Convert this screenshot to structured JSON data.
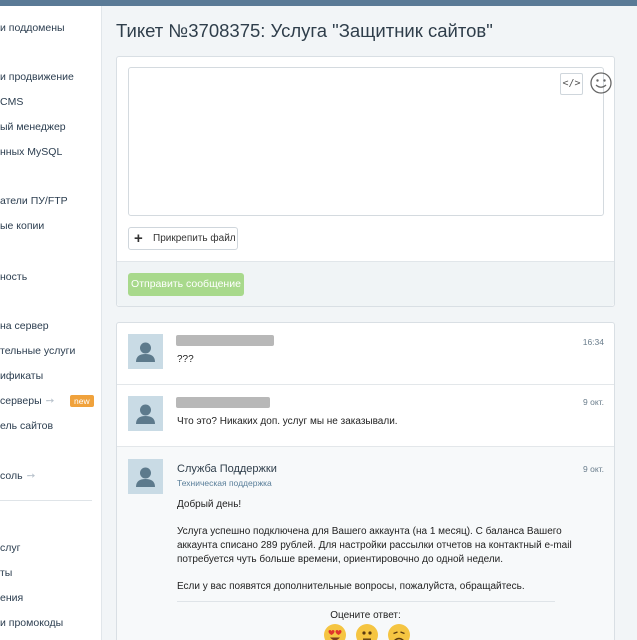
{
  "sidebar": {
    "items": [
      {
        "label": "и поддомены"
      },
      {
        "label": "и продвижение"
      },
      {
        "label": "CMS"
      },
      {
        "label": "ый менеджер"
      },
      {
        "label": "нных MySQL"
      },
      {
        "label": "атели ПУ/FTP"
      },
      {
        "label": "ые копии"
      },
      {
        "label": "ность"
      },
      {
        "label": "на сервер"
      },
      {
        "label": "тельные услуги"
      },
      {
        "label": "ификаты"
      },
      {
        "label": "серверы",
        "arrow": "➙",
        "badge": "new"
      },
      {
        "label": "ель сайтов"
      },
      {
        "label": "соль",
        "arrow": "➙"
      },
      {
        "label": "слуг"
      },
      {
        "label": "ты"
      },
      {
        "label": "ения"
      },
      {
        "label": "и промокоды"
      }
    ]
  },
  "ticket": {
    "title": "Тикет №3708375: Услуга \"Защитник сайтов\""
  },
  "reply": {
    "code_button_label": "</>",
    "attach_label": "Прикрепить файл",
    "attach_plus": "+",
    "send_label": "Отправить сообщение"
  },
  "messages": [
    {
      "time": "16:34",
      "text": "???"
    },
    {
      "time": "9 окт.",
      "text": "Что это? Никаких доп. услуг мы не заказывали."
    },
    {
      "time": "9 окт.",
      "author": "Служба Поддержки",
      "role": "Техническая поддержка",
      "greeting": "Добрый день!",
      "body": "Услуга успешно подключена для Вашего аккаунта (на 1 месяц). С баланса Вашего аккаунта списано 289 рублей. Для настройки рассылки отчетов на контактный e-mail потребуется чуть больше времени, ориентировочно до одной недели.",
      "closing": "Если у вас появятся дополнительные вопросы, пожалуйста, обращайтесь.",
      "rate_label": "Оцените ответ:"
    }
  ],
  "emoji_icons": [
    "heart-eyes-emoji-icon",
    "neutral-face-emoji-icon",
    "disappointed-face-emoji-icon"
  ],
  "colors": {
    "send_button": "#a8d98c",
    "badge": "#f0a23c",
    "avatar_bg": "#c9dbe5"
  }
}
